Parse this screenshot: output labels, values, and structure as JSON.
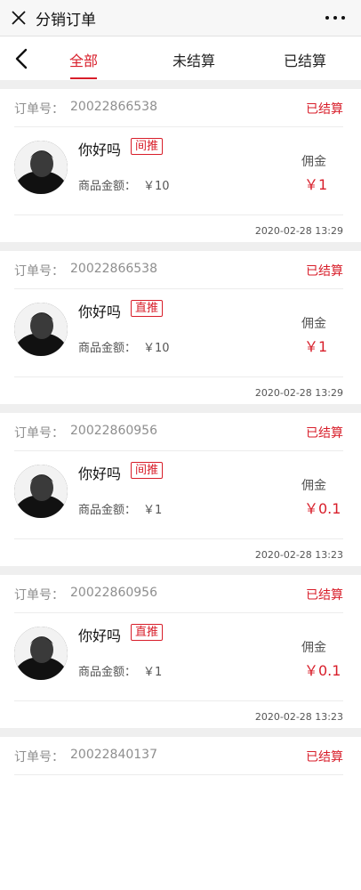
{
  "titlebar": {
    "title": "分销订单",
    "close_icon": "close-icon",
    "more_icon": "more-icon"
  },
  "tabs": [
    {
      "label": "全部",
      "active": true
    },
    {
      "label": "未结算",
      "active": false
    },
    {
      "label": "已结算",
      "active": false
    }
  ],
  "accent_color": "#d81e2a",
  "order_label": "订单号：",
  "amount_label": "商品金额：",
  "commission_label": "佣金",
  "orders": [
    {
      "order_no": "20022866538",
      "status": "已结算",
      "name": "你好吗",
      "tag": "间推",
      "amount": "￥10",
      "commission": "￥1",
      "time": "2020-02-28 13:29"
    },
    {
      "order_no": "20022866538",
      "status": "已结算",
      "name": "你好吗",
      "tag": "直推",
      "amount": "￥10",
      "commission": "￥1",
      "time": "2020-02-28 13:29"
    },
    {
      "order_no": "20022860956",
      "status": "已结算",
      "name": "你好吗",
      "tag": "间推",
      "amount": "￥1",
      "commission": "￥0.1",
      "time": "2020-02-28 13:23"
    },
    {
      "order_no": "20022860956",
      "status": "已结算",
      "name": "你好吗",
      "tag": "直推",
      "amount": "￥1",
      "commission": "￥0.1",
      "time": "2020-02-28 13:23"
    },
    {
      "order_no": "20022840137",
      "status": "已结算"
    }
  ]
}
